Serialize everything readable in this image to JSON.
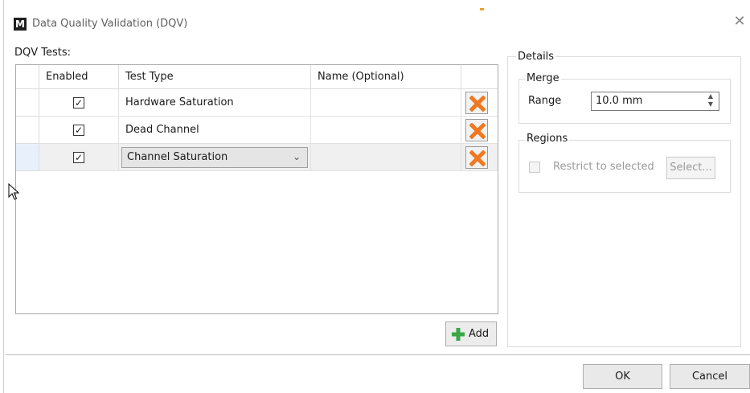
{
  "window": {
    "icon_glyph": "M",
    "title": "Data Quality Validation (DQV)",
    "close_glyph": "✕"
  },
  "tests": {
    "label": "DQV Tests:",
    "columns": [
      "Enabled",
      "Test Type",
      "Name (Optional)"
    ],
    "rows": [
      {
        "enabled": true,
        "type": "Hardware Saturation",
        "name": "",
        "editing": false
      },
      {
        "enabled": true,
        "type": "Dead Channel",
        "name": "",
        "editing": false
      },
      {
        "enabled": true,
        "type": "Channel Saturation",
        "name": "",
        "editing": true
      }
    ],
    "check_glyph": "✓",
    "dropdown_glyph": "⌄",
    "add_label": "Add"
  },
  "details": {
    "label": "Details",
    "merge": {
      "label": "Merge",
      "range_label": "Range",
      "range_value": "10.0 mm"
    },
    "regions": {
      "label": "Regions",
      "restrict_label": "Restrict to selected",
      "restrict_checked": false,
      "select_label": "Select..."
    }
  },
  "footer": {
    "ok_label": "OK",
    "cancel_label": "Cancel"
  },
  "colors": {
    "delete_icon": "#f07820",
    "add_icon": "#3aa646",
    "selected_row": "#f0f0f0"
  }
}
